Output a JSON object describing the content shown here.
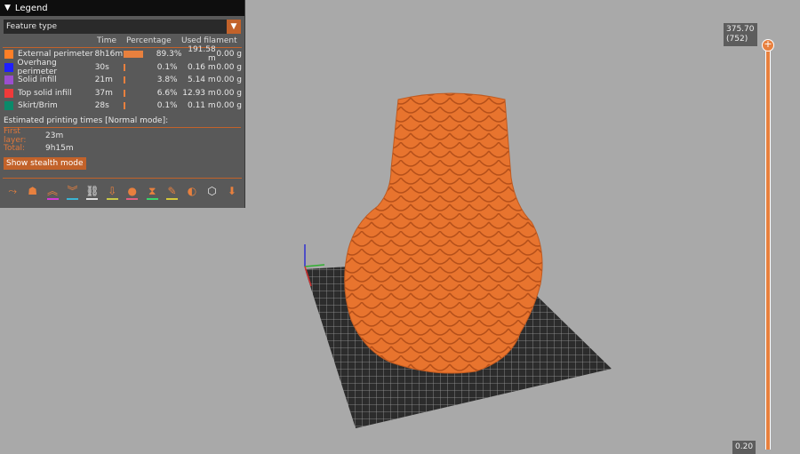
{
  "legend": {
    "title": "Legend",
    "view_type": "Feature type",
    "headers": {
      "time": "Time",
      "percentage": "Percentage",
      "used": "Used filament"
    },
    "rows": [
      {
        "name": "External perimeter",
        "color": "#ff7f27",
        "time": "8h16m",
        "percent": "89.3%",
        "pct": 89.3,
        "length": "191.58 m",
        "weight": "0.00 g"
      },
      {
        "name": "Overhang perimeter",
        "color": "#1f1fff",
        "time": "30s",
        "percent": "0.1%",
        "pct": 0.1,
        "length": "0.16 m",
        "weight": "0.00 g"
      },
      {
        "name": "Solid infill",
        "color": "#9a4fcf",
        "time": "21m",
        "percent": "3.8%",
        "pct": 3.8,
        "length": "5.14 m",
        "weight": "0.00 g"
      },
      {
        "name": "Top solid infill",
        "color": "#f03a3a",
        "time": "37m",
        "percent": "6.6%",
        "pct": 6.6,
        "length": "12.93 m",
        "weight": "0.00 g"
      },
      {
        "name": "Skirt/Brim",
        "color": "#0b8a6a",
        "time": "28s",
        "percent": "0.1%",
        "pct": 0.1,
        "length": "0.11 m",
        "weight": "0.00 g"
      }
    ],
    "estimated": "Estimated printing times [Normal mode]:",
    "first_layer_label": "First layer:",
    "first_layer": "23m",
    "total_label": "Total:",
    "total": "9h15m",
    "stealth_button": "Show stealth mode"
  },
  "toolbar": [
    {
      "icon": "travel-icon",
      "g": "⤳",
      "u": ""
    },
    {
      "icon": "wipe-icon",
      "g": "☗",
      "u": ""
    },
    {
      "icon": "retractions-icon",
      "g": "︽",
      "u": "#d43bd4"
    },
    {
      "icon": "deretractions-icon",
      "g": "︾",
      "u": "#3bb4d4"
    },
    {
      "icon": "seams-icon",
      "g": "⛓",
      "u": "#dddddd"
    },
    {
      "icon": "tool-changes-icon",
      "g": "⇩",
      "u": "#c8c84a"
    },
    {
      "icon": "color-changes-icon",
      "g": "●",
      "u": "#e06080"
    },
    {
      "icon": "pause-icon",
      "g": "⧗",
      "u": "#3bd46b"
    },
    {
      "icon": "custom-gcode-icon",
      "g": "✎",
      "u": "#d4c83b"
    },
    {
      "icon": "center-of-gravity-icon",
      "g": "◐",
      "u": ""
    },
    {
      "icon": "shells-icon",
      "g": "⬡",
      "u": ""
    },
    {
      "icon": "tool-marker-icon",
      "g": "⬇",
      "u": ""
    }
  ],
  "slider": {
    "top_value": "375.70",
    "top_layer": "(752)",
    "bottom_value": "0.20"
  }
}
